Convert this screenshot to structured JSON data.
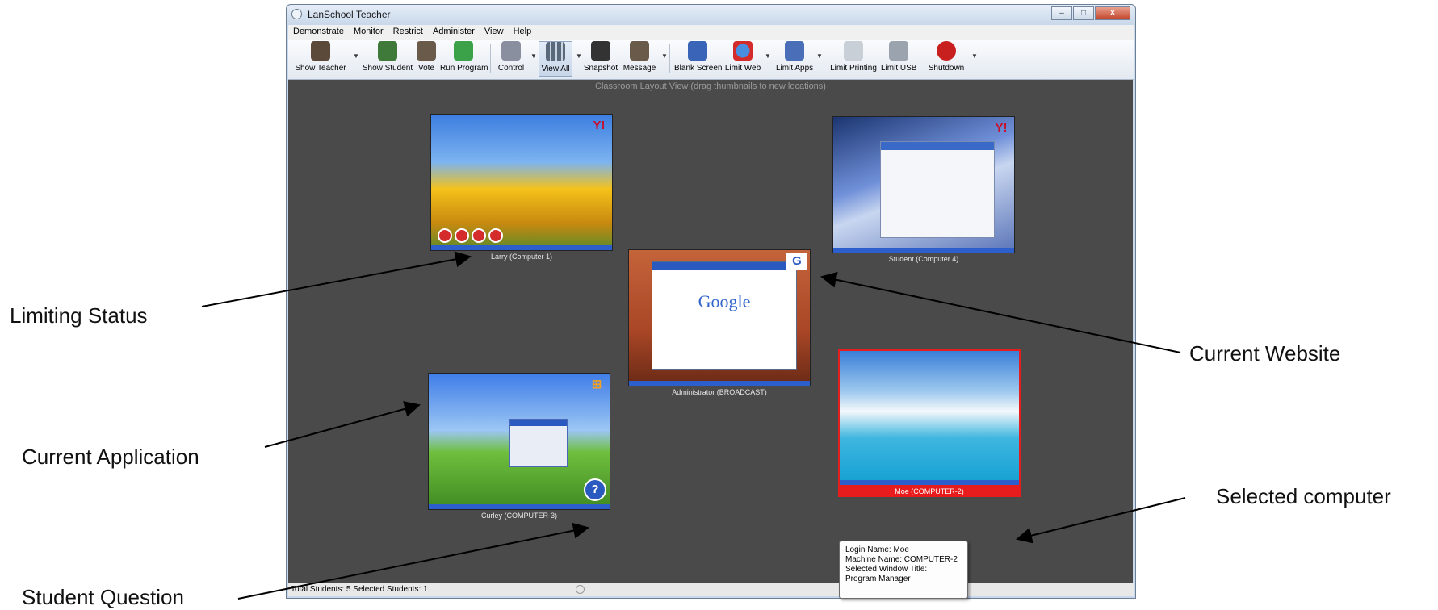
{
  "window": {
    "title": "LanSchool Teacher",
    "controls": {
      "minimize": "–",
      "maximize": "□",
      "close": "X"
    }
  },
  "menu": [
    "Demonstrate",
    "Monitor",
    "Restrict",
    "Administer",
    "View",
    "Help"
  ],
  "toolbar": {
    "buttons": [
      {
        "label": "Show Teacher",
        "icon": "teacher-icon",
        "dropdown": true
      },
      {
        "label": "Show Student",
        "icon": "student-screen-icon"
      },
      {
        "label": "Vote",
        "icon": "vote-icon"
      },
      {
        "label": "Run Program",
        "icon": "run-program-icon"
      },
      {
        "label": "Control",
        "icon": "control-pen-icon",
        "dropdown": true
      },
      {
        "label": "View All",
        "icon": "view-all-grid-icon",
        "dropdown": true,
        "active": true
      },
      {
        "label": "Snapshot",
        "icon": "camera-icon"
      },
      {
        "label": "Message",
        "icon": "message-icon",
        "dropdown": true
      },
      {
        "label": "Blank Screen",
        "icon": "blank-screen-icon"
      },
      {
        "label": "Limit Web",
        "icon": "limit-web-icon",
        "dropdown": true
      },
      {
        "label": "Limit Apps",
        "icon": "limit-apps-icon",
        "dropdown": true
      },
      {
        "label": "Limit Printing",
        "icon": "printer-icon"
      },
      {
        "label": "Limit USB",
        "icon": "usb-icon"
      },
      {
        "label": "Shutdown",
        "icon": "shutdown-icon",
        "dropdown": true
      }
    ]
  },
  "classroom": {
    "hint": "Classroom Layout View (drag thumbnails to new locations)",
    "students": [
      {
        "caption": "Larry (Computer 1)",
        "corner": "Y!",
        "accent": "#f4c21a"
      },
      {
        "caption": "Student (Computer 4)",
        "corner": "Y!",
        "accent": "#7c9dd8"
      },
      {
        "caption": "Administrator (BROADCAST)",
        "corner": "G",
        "page_text": "Google",
        "accent": "#b5472a"
      },
      {
        "caption": "Curley (COMPUTER-3)",
        "corner": "⊞",
        "accent": "#5aa53a"
      },
      {
        "caption": "Moe (COMPUTER-2)",
        "corner": "",
        "accent": "#1ba7d8",
        "selected": true
      }
    ]
  },
  "tooltip": {
    "login": "Login Name: Moe",
    "machine": "Machine Name: COMPUTER-2",
    "window_label": "Selected Window Title:",
    "window_title": "Program Manager"
  },
  "status": {
    "text": "Total Students: 5   Selected Students: 1"
  },
  "callouts": {
    "limiting_status": "Limiting Status",
    "current_website": "Current Website",
    "current_application": "Current Application",
    "selected_computer": "Selected computer",
    "student_question": "Student Question"
  },
  "colors": {
    "canvas": "#4a4a4a",
    "selection": "#e81c1c",
    "accent_blue": "#2d5fcc"
  }
}
